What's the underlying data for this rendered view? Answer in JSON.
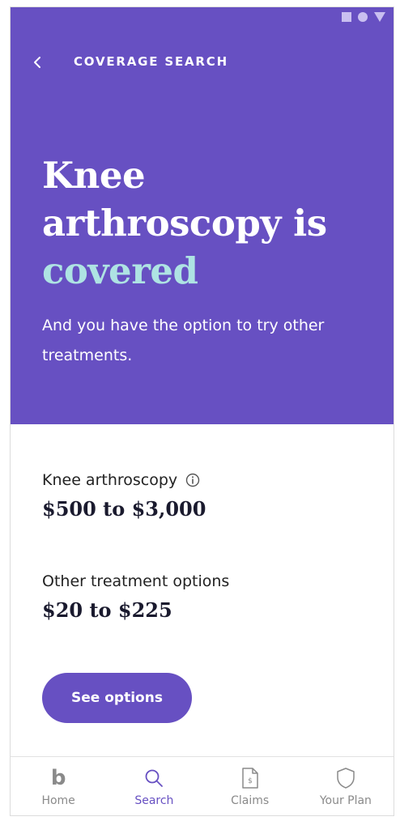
{
  "header": {
    "back_label": "‹",
    "title": "COVERAGE SEARCH"
  },
  "hero": {
    "headline_line1": "Knee",
    "headline_line2": "arthroscopy is",
    "headline_line3": "covered",
    "subtext": "And you have the option to try other treatments."
  },
  "coverage": [
    {
      "label": "Knee arthroscopy",
      "price": "$500 to $3,000"
    },
    {
      "label": "Other treatment options",
      "price": "$20 to $225"
    }
  ],
  "cta": {
    "label": "See options"
  },
  "tabbar": {
    "home": {
      "icon": "b-logo-icon",
      "glyph": "b",
      "label": "Home"
    },
    "search": {
      "icon": "search-icon",
      "label": "Search"
    },
    "claims": {
      "icon": "claims-document-icon",
      "label": "Claims"
    },
    "plan": {
      "icon": "shield-icon",
      "label": "Your Plan"
    }
  },
  "colors": {
    "brand_purple": "#6750c2",
    "highlight_teal": "#aee3e3",
    "inactive_gray": "#8a8a8a"
  }
}
